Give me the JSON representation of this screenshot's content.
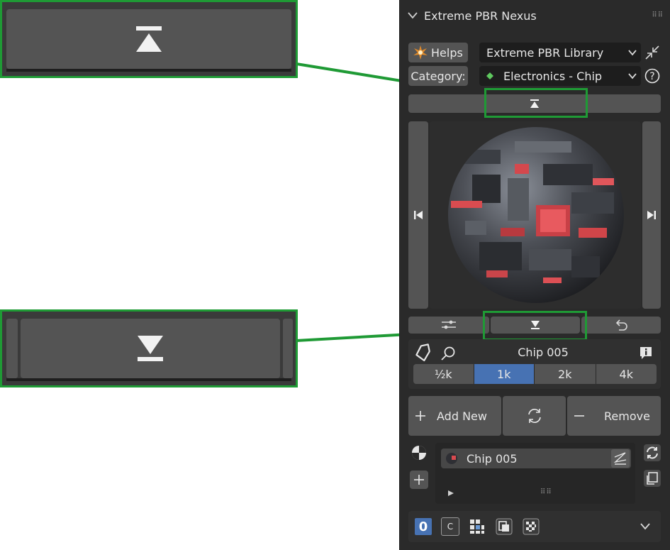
{
  "panel": {
    "title": "Extreme PBR Nexus",
    "helps_label": "Helps",
    "library_value": "Extreme PBR Library",
    "category_label": "Category:",
    "category_value": "Electronics - Chip",
    "material_name": "Chip 005",
    "resolutions": [
      "½k",
      "1k",
      "2k",
      "4k"
    ],
    "selected_resolution": "1k",
    "add_new_label": "Add New",
    "remove_label": "Remove",
    "slot_material_name": "Chip 005",
    "slot_index": "0",
    "c_label": "C"
  },
  "colors": {
    "highlight": "#1f9a35",
    "accent": "#4772b3",
    "panel_bg": "#2a2a2a",
    "button_bg": "#545454"
  },
  "icons": {
    "collapse_up": "collapse-up-icon",
    "expand_down": "expand-down-icon",
    "prev": "skip-previous-icon",
    "next": "skip-next-icon"
  }
}
